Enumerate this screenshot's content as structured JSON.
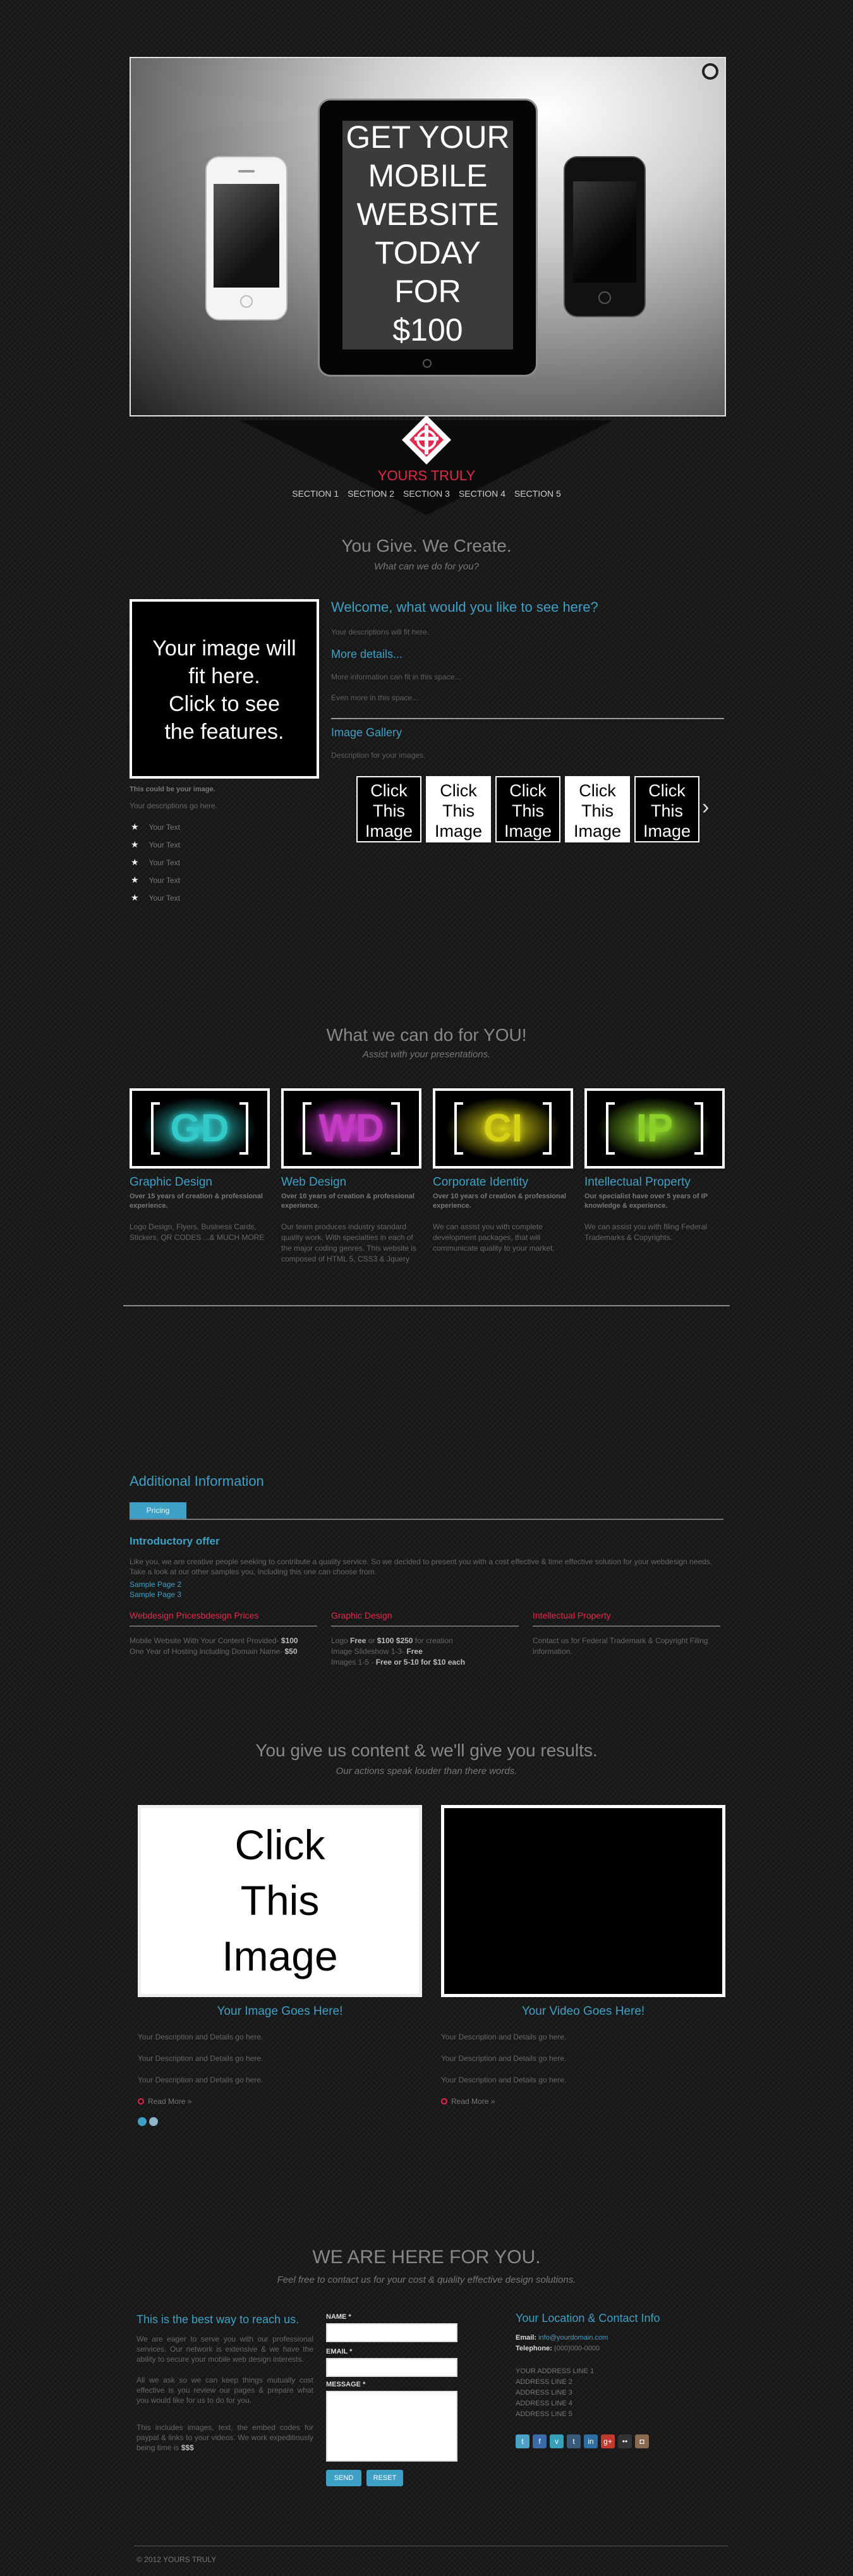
{
  "hero": {
    "headline_lines": [
      "GET YOUR",
      "MOBILE",
      "WEBSITE",
      "TODAY",
      "FOR",
      "$100"
    ]
  },
  "brand": {
    "name": "YOURS TRULY"
  },
  "nav": {
    "items": [
      "SECTION 1",
      "SECTION 2",
      "SECTION 3",
      "SECTION 4",
      "SECTION 5"
    ]
  },
  "section1": {
    "title": "You Give. We Create.",
    "subtitle": "What can we do for you?",
    "feature_box_lines": [
      "Your image will",
      "fit here.",
      "Click to see",
      "the features."
    ],
    "feature_caption": "This could be your image.",
    "feature_desc": "Your descriptions go here.",
    "feature_items": [
      "Your Text",
      "Your Text",
      "Your Text",
      "Your Text",
      "Your Text"
    ],
    "welcome_title": "Welcome, what would you like to see here?",
    "welcome_desc": "Your descriptions will fit here.",
    "more_title": "More details...",
    "more_lines": [
      "More information can fit in this space...",
      "Even more in this space..."
    ],
    "gallery_title": "Image Gallery",
    "gallery_desc": "Description for your images.",
    "thumbs": [
      "Click This Image",
      "Click This Image",
      "Click This Image",
      "Click This Image",
      "Click This Image"
    ],
    "next_arrow": "›"
  },
  "section2": {
    "title": "What we can do for YOU!",
    "subtitle": "Assist with your presentations.",
    "services": [
      {
        "abbr": "GD",
        "color": "#33c9c9",
        "title": "Graphic Design",
        "sub": "Over 15 years of creation & professional experience.",
        "body": "Logo Design, Flyers, Business Cards, Stickers, QR CODES ...& MUCH MORE"
      },
      {
        "abbr": "WD",
        "color": "#c23ac2",
        "title": "Web Design",
        "sub": "Over 10 years of creation & professional experience.",
        "body": "Our team produces industry standard quality work. With specialties in each of the major coding genres. This website is composed of HTML 5, CSS3 & Jquery"
      },
      {
        "abbr": "CI",
        "color": "#d7d117",
        "title": "Corporate Identity",
        "sub": "Over 10 years of creation & professional experience.",
        "body": "We can assist you with complete development packages, that will communicate quality to your market."
      },
      {
        "abbr": "IP",
        "color": "#8bd12a",
        "title": "Intellectual Property",
        "sub": "Our specialist have over 5 years of IP knowledge & experience.",
        "body": "We can assist you with filing Federal Trademarks & Copyrights."
      }
    ]
  },
  "section3": {
    "title": "Additional Information",
    "tab": "Pricing",
    "offer_title": "Introductory offer",
    "offer_text": "Like you, we are creative people seeking to contribute a quality service. So we decided to present you with a cost effective & time effective solution for your webdesign needs. Take a look at our other samples you, including this one can choose from.",
    "sample_links": [
      "Sample Page 2",
      "Sample Page 3"
    ],
    "prices": [
      {
        "title": "Webdesign Pricesbdesign Prices",
        "lines": [
          [
            "Mobile Website With Your Content Provided- ",
            "$100"
          ],
          [
            "One Year of Hosting including Domain Name- ",
            "$50"
          ]
        ]
      },
      {
        "title": "Graphic Design",
        "lines": [
          [
            "Logo ",
            "Free"
          ],
          [
            " or ",
            "$100 $250"
          ],
          [
            " for creation",
            ""
          ]
        ],
        "extra": [
          [
            "Image Slideshow 1-3- ",
            "Free"
          ],
          [
            "Images 1-5 - ",
            "Free or 5-10 for $10 each"
          ]
        ]
      },
      {
        "title": "Intellectual Property",
        "lines": [
          [
            "Contact us for Federal Trademark & Copyright Filing information.",
            ""
          ]
        ]
      }
    ]
  },
  "section4": {
    "title": "You give us content & we'll give you results.",
    "subtitle": "Our actions speak louder than there words.",
    "image_panel_lines": [
      "Click",
      "This",
      "Image"
    ],
    "left_title": "Your Image Goes Here!",
    "right_title": "Your Video Goes Here!",
    "desc": "Your Description and Details go here.",
    "read_more": "Read More »"
  },
  "section5": {
    "title": "WE ARE HERE FOR YOU.",
    "subtitle": "Feel free to contact us for your cost & quality effective design solutions.",
    "reach_title": "This is the best way to reach us.",
    "reach_p1": "We are eager to serve you with our professional services. Our network is extensive & we have the ability to secure your mobile web design interests.",
    "reach_p2": "All we ask so we can keep things mutually cost effective is you review our pages & prepare what you would like for us to do for you.",
    "reach_p3_pre": "This includes images, text, the embed codes for paypal & links to your videos. We work expeditiously being time is ",
    "reach_p3_bold": "$$$",
    "name_label": "NAME *",
    "email_label": "EMAIL *",
    "message_label": "MESSAGE *",
    "send": "SEND",
    "reset": "RESET",
    "loc_title": "Your Location & Contact Info",
    "email_key": "Email:",
    "email_val": "info@yourdomain.com",
    "tel_key": "Telephone:",
    "tel_val": "(000)000-0000",
    "address": [
      "YOUR ADDRESS LINE 1",
      "ADDRESS LINE 2",
      "ADDRESS LINE 3",
      "ADDRESS LINE 4",
      "ADDRESS LINE 5"
    ],
    "social": [
      {
        "icon": "twitter-icon",
        "glyph": "t",
        "color": "#4aa3c7"
      },
      {
        "icon": "facebook-icon",
        "glyph": "f",
        "color": "#3b6aa8"
      },
      {
        "icon": "vimeo-icon",
        "glyph": "v",
        "color": "#36a0b8"
      },
      {
        "icon": "tumblr-icon",
        "glyph": "t",
        "color": "#3a5a7a"
      },
      {
        "icon": "linkedin-icon",
        "glyph": "in",
        "color": "#2f6ea2"
      },
      {
        "icon": "googleplus-icon",
        "glyph": "g+",
        "color": "#c13a2e"
      },
      {
        "icon": "flickr-icon",
        "glyph": "••",
        "color": "#333333"
      },
      {
        "icon": "instagram-icon",
        "glyph": "◘",
        "color": "#8a6a4e"
      }
    ],
    "copyright": "© 2012 YOURS TRULY"
  }
}
